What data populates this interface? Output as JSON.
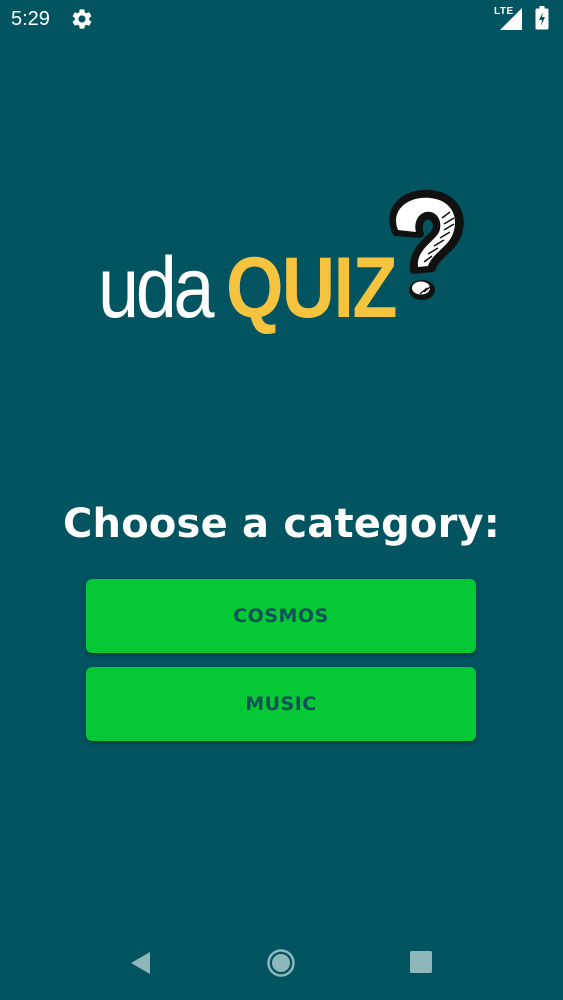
{
  "status_bar": {
    "time": "5:29",
    "network_type": "LTE",
    "icons": [
      "gear-icon",
      "signal-icon",
      "battery-charging-icon"
    ]
  },
  "logo": {
    "prefix": "uda",
    "highlight": "QUIZ",
    "icon": "question-mark-icon",
    "prefix_color": "#ffffff",
    "highlight_color": "#f5c33e"
  },
  "heading": "Choose a category:",
  "categories": [
    {
      "label": "COSMOS"
    },
    {
      "label": "MUSIC"
    }
  ],
  "nav_bar": {
    "icons": [
      "back-icon",
      "home-icon",
      "recents-icon"
    ]
  },
  "colors": {
    "background": "#015460",
    "button": "#04c934",
    "button_text": "#0e5158",
    "accent": "#f5c33e"
  }
}
